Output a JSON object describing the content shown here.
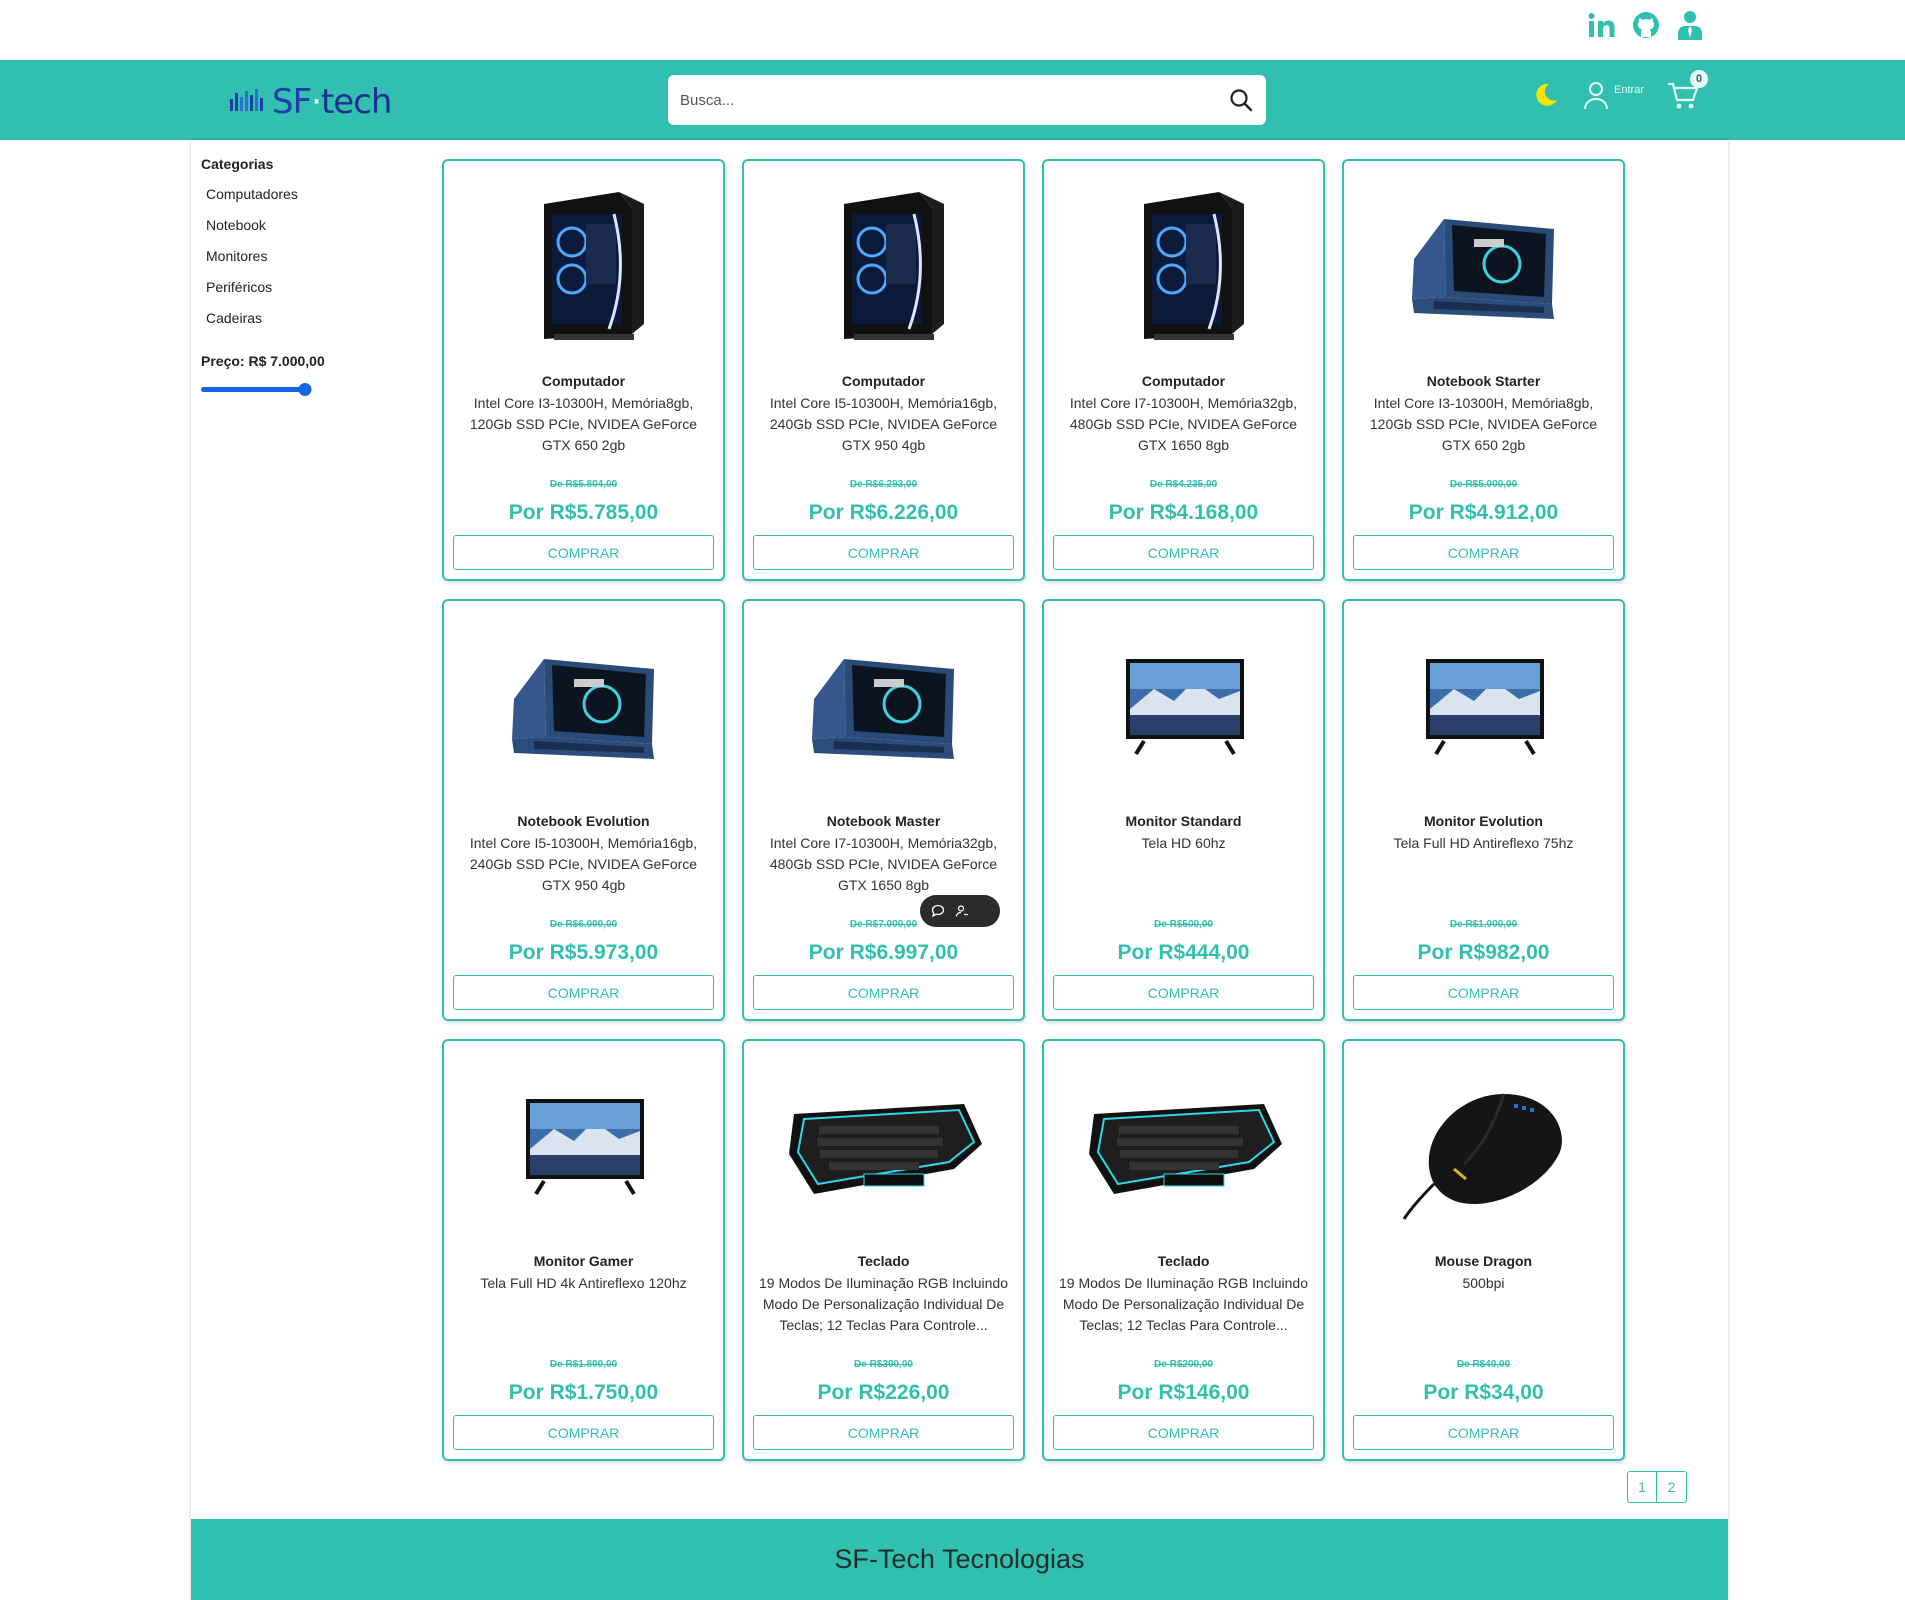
{
  "social": {
    "linkedin_icon": "linkedin-icon",
    "github_icon": "github-icon",
    "profile_icon": "profile-icon"
  },
  "header": {
    "logo": {
      "prefix": "SF",
      "dot": "·",
      "suffix": "tech"
    },
    "search": {
      "placeholder": "Busca..."
    },
    "login_label": "Entrar",
    "cart_count": "0"
  },
  "sidebar": {
    "title": "Categorias",
    "categories": [
      "Computadores",
      "Notebook",
      "Monitores",
      "Periféricos",
      "Cadeiras"
    ],
    "price_label": "Preço: R$ 7.000,00",
    "price_slider_fraction": 1.0
  },
  "products": [
    {
      "name": "Computador",
      "desc": "Intel Core I3-10300H, Memória8gb, 120Gb SSD PCIe, NVIDEA GeForce GTX 650 2gb",
      "old_price": "De R$5.804,00",
      "new_price": "Por R$5.785,00",
      "buy": "COMPRAR",
      "image": "desktop-pc"
    },
    {
      "name": "Computador",
      "desc": "Intel Core I5-10300H, Memória16gb, 240Gb SSD PCIe, NVIDEA GeForce GTX 950 4gb",
      "old_price": "De R$6.293,00",
      "new_price": "Por R$6.226,00",
      "buy": "COMPRAR",
      "image": "desktop-pc"
    },
    {
      "name": "Computador",
      "desc": "Intel Core I7-10300H, Memória32gb, 480Gb SSD PCIe, NVIDEA GeForce GTX 1650 8gb",
      "old_price": "De R$4.235,00",
      "new_price": "Por R$4.168,00",
      "buy": "COMPRAR",
      "image": "desktop-pc"
    },
    {
      "name": "Notebook Starter",
      "desc": "Intel Core I3-10300H, Memória8gb, 120Gb SSD PCIe, NVIDEA GeForce GTX 650 2gb",
      "old_price": "De R$5.000,00",
      "new_price": "Por R$4.912,00",
      "buy": "COMPRAR",
      "image": "laptop"
    },
    {
      "name": "Notebook Evolution",
      "desc": "Intel Core I5-10300H, Memória16gb, 240Gb SSD PCIe, NVIDEA GeForce GTX 950 4gb",
      "old_price": "De R$6.000,00",
      "new_price": "Por R$5.973,00",
      "buy": "COMPRAR",
      "image": "laptop"
    },
    {
      "name": "Notebook Master",
      "desc": "Intel Core I7-10300H, Memória32gb, 480Gb SSD PCIe, NVIDEA GeForce GTX 1650 8gb",
      "old_price": "De R$7.000,00",
      "new_price": "Por R$6.997,00",
      "buy": "COMPRAR",
      "image": "laptop"
    },
    {
      "name": "Monitor Standard",
      "desc": "Tela HD 60hz",
      "old_price": "De R$500,00",
      "new_price": "Por R$444,00",
      "buy": "COMPRAR",
      "image": "monitor"
    },
    {
      "name": "Monitor Evolution",
      "desc": "Tela Full HD Antireflexo 75hz",
      "old_price": "De R$1.000,00",
      "new_price": "Por R$982,00",
      "buy": "COMPRAR",
      "image": "monitor"
    },
    {
      "name": "Monitor Gamer",
      "desc": "Tela Full HD 4k Antireflexo 120hz",
      "old_price": "De R$1.800,00",
      "new_price": "Por R$1.750,00",
      "buy": "COMPRAR",
      "image": "monitor"
    },
    {
      "name": "Teclado",
      "desc": "19 Modos De Iluminação RGB Incluindo Modo De Personalização Individual De Teclas; 12 Teclas Para Controle...",
      "old_price": "De R$300,00",
      "new_price": "Por R$226,00",
      "buy": "COMPRAR",
      "image": "keyboard"
    },
    {
      "name": "Teclado",
      "desc": "19 Modos De Iluminação RGB Incluindo Modo De Personalização Individual De Teclas; 12 Teclas Para Controle...",
      "old_price": "De R$200,00",
      "new_price": "Por R$146,00",
      "buy": "COMPRAR",
      "image": "keyboard"
    },
    {
      "name": "Mouse Dragon",
      "desc": "500bpi",
      "old_price": "De R$40,00",
      "new_price": "Por R$34,00",
      "buy": "COMPRAR",
      "image": "mouse"
    }
  ],
  "pagination": [
    "1",
    "2"
  ],
  "footer": {
    "text": "SF-Tech Tecnologias"
  },
  "colors": {
    "accent": "#31c0b0",
    "slider": "#1565e0",
    "moon": "#f5e600"
  }
}
